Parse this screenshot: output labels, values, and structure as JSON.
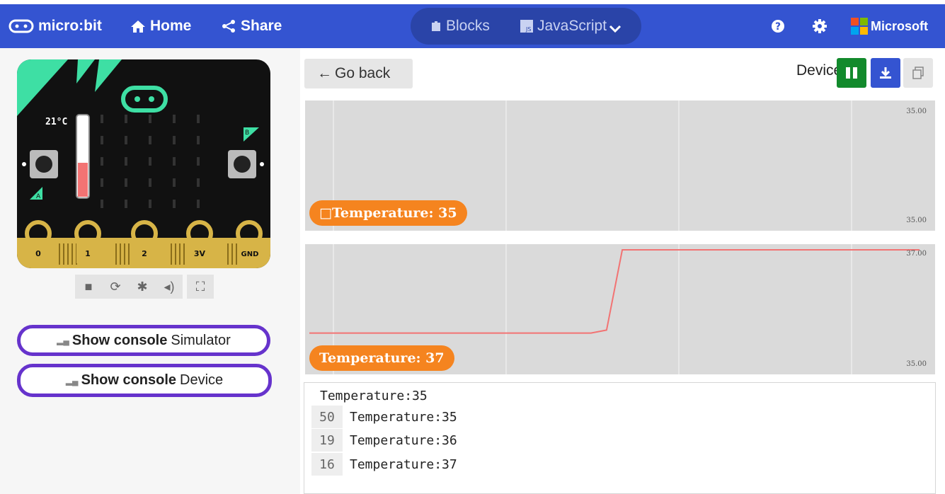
{
  "header": {
    "logo_label": "micro:bit",
    "home_label": "Home",
    "share_label": "Share",
    "blocks_label": "Blocks",
    "javascript_label": "JavaScript",
    "microsoft_label": "Microsoft"
  },
  "simulator": {
    "temperature_readout": "21°C",
    "temperature_level": 0.42,
    "button_a_label": "A",
    "button_b_label": "B",
    "pins": [
      "0",
      "1",
      "2",
      "3V",
      "GND"
    ],
    "accent_color": "#3edfa4",
    "thermo_color": "#f27373"
  },
  "console_buttons": {
    "simulator": {
      "prefix": "Show console",
      "suffix": "Simulator"
    },
    "device": {
      "prefix": "Show console",
      "suffix": "Device"
    }
  },
  "device_panel": {
    "go_back_label": "Go back",
    "device_label": "Device"
  },
  "charts": [
    {
      "badge": "□Temperature: 35",
      "y_top": "35.00",
      "y_bottom": "35.00"
    },
    {
      "badge": "Temperature: 37",
      "y_top": "37.00",
      "y_bottom": "35.00"
    }
  ],
  "chart_data": [
    {
      "type": "line",
      "series": [
        {
          "name": "Temperature",
          "values": [
            35,
            35,
            35,
            35,
            35,
            35,
            35,
            35,
            35,
            35
          ]
        }
      ],
      "ylim": [
        35,
        35
      ],
      "grid": true,
      "line_color": "#f27373"
    },
    {
      "type": "line",
      "series": [
        {
          "name": "Temperature",
          "values": [
            35.6,
            35.6,
            35.6,
            35.6,
            35.6,
            35.6,
            35.6,
            35.6,
            35.6,
            35.6,
            35.6,
            35.6,
            35.6,
            35.6,
            35.6,
            35.6,
            35.6,
            35.6,
            35.6,
            35.65,
            37,
            37,
            37,
            37,
            37,
            37,
            37,
            37,
            37,
            37,
            37,
            37,
            37,
            37,
            37,
            37,
            37,
            37,
            37,
            37
          ]
        }
      ],
      "ylim": [
        35,
        37
      ],
      "grid": true,
      "line_color": "#f27373"
    }
  ],
  "console": {
    "first_line": "Temperature:35",
    "rows": [
      {
        "count": "50",
        "text": "Temperature:35"
      },
      {
        "count": "19",
        "text": "Temperature:36"
      },
      {
        "count": "16",
        "text": "Temperature:37"
      }
    ]
  }
}
